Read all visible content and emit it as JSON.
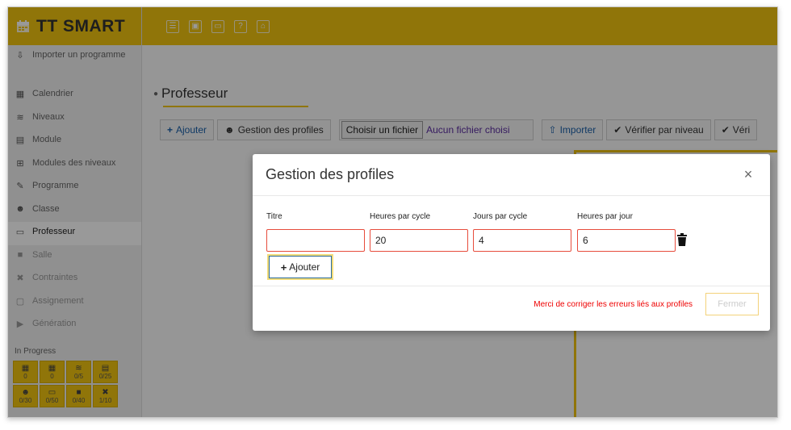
{
  "app": {
    "title": "TT SMART"
  },
  "sidebar": {
    "items": [
      {
        "label": "Importer un programme",
        "icon": "import-icon"
      },
      {
        "label": "Calendrier",
        "icon": "calendar-icon"
      },
      {
        "label": "Niveaux",
        "icon": "layers-icon"
      },
      {
        "label": "Module",
        "icon": "book-icon"
      },
      {
        "label": "Modules des niveaux",
        "icon": "sitemap-icon"
      },
      {
        "label": "Programme",
        "icon": "pen-icon"
      },
      {
        "label": "Classe",
        "icon": "users-icon"
      },
      {
        "label": "Professeur",
        "icon": "teacher-icon"
      },
      {
        "label": "Salle",
        "icon": "room-icon"
      },
      {
        "label": "Contraintes",
        "icon": "tools-icon"
      },
      {
        "label": "Assignement",
        "icon": "assign-icon"
      },
      {
        "label": "Génération",
        "icon": "play-icon"
      }
    ],
    "in_progress_label": "In Progress",
    "progress_tiles": [
      {
        "icon": "calendar-icon",
        "value": "0"
      },
      {
        "icon": "calendar-icon",
        "value": "0"
      },
      {
        "icon": "layers-icon",
        "value": "0/5"
      },
      {
        "icon": "book-icon",
        "value": "0/25"
      },
      {
        "icon": "users-icon",
        "value": "0/30"
      },
      {
        "icon": "teacher-icon",
        "value": "0/50"
      },
      {
        "icon": "room-icon",
        "value": "0/40"
      },
      {
        "icon": "tools-icon",
        "value": "1/10"
      }
    ]
  },
  "page": {
    "title": "Professeur",
    "toolbar": {
      "add_label": "Ajouter",
      "profiles_label": "Gestion des profiles",
      "file_button": "Choisir un fichier",
      "file_status": "Aucun fichier choisi",
      "import_label": "Importer",
      "verify_level_label": "Vérifier par niveau",
      "verify_more_label": "Véri"
    }
  },
  "modal": {
    "title": "Gestion des profiles",
    "columns": [
      "Titre",
      "Heures par cycle",
      "Jours par cycle",
      "Heures par jour"
    ],
    "row": {
      "titre": "",
      "heures_par_cycle": "20",
      "jours_par_cycle": "4",
      "heures_par_jour": "6"
    },
    "add_label": "Ajouter",
    "error_message": "Merci de corriger les erreurs liés aux profiles",
    "close_label": "Fermer"
  },
  "colors": {
    "brand": "#f1c40f",
    "error": "#e00000",
    "link": "#1a5fa8"
  }
}
